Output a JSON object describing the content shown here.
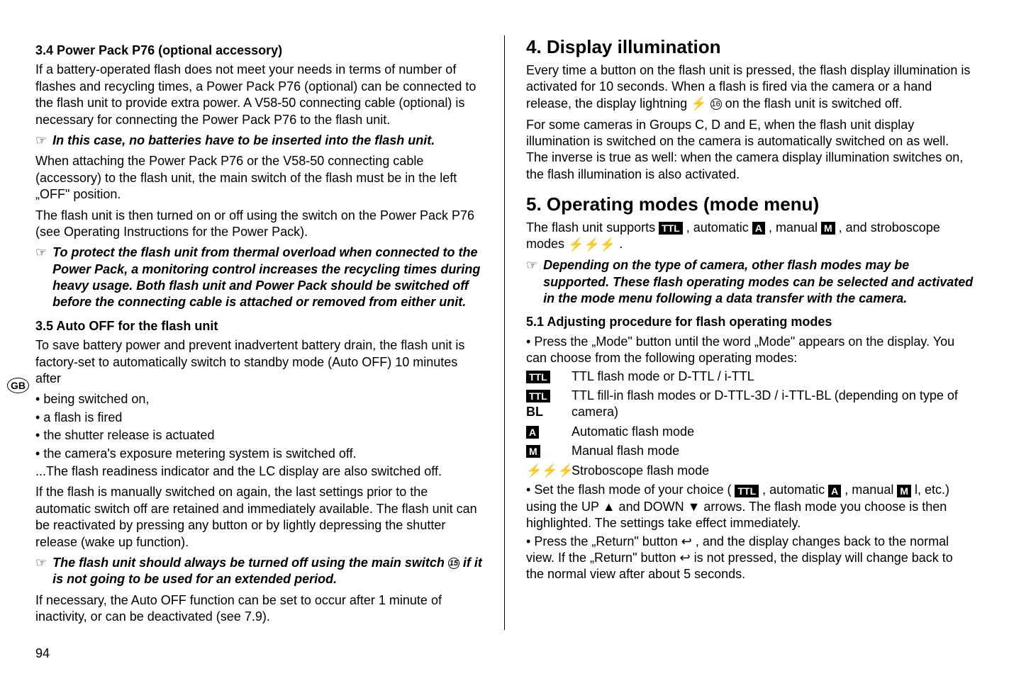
{
  "left": {
    "h34": "3.4 Power Pack P76 (optional accessory)",
    "p34a": "If a battery-operated flash does not meet your needs in terms of number of flashes and recycling times, a Power Pack P76 (optional) can be connected to the flash unit to provide extra power. A V58-50 connecting cable (optional) is necessary for connecting the Power Pack P76 to the flash unit.",
    "n34a": "In this case, no batteries have to be inserted into the flash unit.",
    "p34b": "When attaching the Power Pack P76 or the V58-50 connecting cable (accessory) to the flash unit, the main switch of the flash must be in the left „OFF\" position.",
    "p34c": "The flash unit is then turned on or off using the switch on the Power Pack P76 (see Operating Instructions for the Power Pack).",
    "n34b": "To protect the flash unit from thermal overload when connected to the Power Pack, a monitoring control increases the recycling times during heavy usage. Both flash unit and Power Pack should be switched off before the connecting cable is attached or removed from either unit.",
    "h35": "3.5 Auto OFF for the flash unit",
    "p35a": "To save battery power and prevent inadvertent battery drain, the flash unit is factory-set to automatically switch to standby mode (Auto OFF) 10 minutes after",
    "li1": "being switched on,",
    "li2": "a flash is fired",
    "li3": "the shutter release is actuated",
    "li4": "the camera's exposure metering system is switched off.",
    "p35b": "...The flash readiness indicator and the LC display are also switched off.",
    "p35c": "If the flash is manually switched on again, the last settings prior to the automatic switch off are retained and immediately available. The flash unit can be reactivated by pressing any button or by lightly depressing the shutter release (wake up function).",
    "n35a_pre": "The flash unit should always be turned off using the main switch ",
    "n35a_post": " if it is not going to be used for an extended period.",
    "p35d": "If necessary, the Auto OFF function can be set to occur after 1 minute of inactivity, or can be deactivated (see 7.9)."
  },
  "right": {
    "h4": "4. Display illumination",
    "p4a_pre": "Every time a button on the flash unit is pressed, the flash display illumination is activated for 10 seconds. When a flash is fired via the camera or a hand release, the display lightning ",
    "p4a_post": " on the flash unit is switched off.",
    "p4b": "For some cameras in Groups C, D and E, when the flash unit display illumination is switched on the camera is automatically switched on as well. The inverse is true as well: when the camera display illumination switches on, the flash illumination is also activated.",
    "h5": "5. Operating modes (mode menu)",
    "p5a_pre": "The flash unit supports ",
    "p5a_mid1": " , automatic ",
    "p5a_mid2": " , manual ",
    "p5a_mid3": " , and stroboscope modes ",
    "p5a_post": " .",
    "n5a": "Depending on the type of camera, other flash modes may be supported. These flash operating modes can be selected and activated in the mode menu following a data transfer with the camera.",
    "h51": "5.1 Adjusting procedure for flash operating modes",
    "li51a": "Press the „Mode\" button until the word „Mode\" appears on the display. You can choose from the following operating modes:",
    "mode_ttl": "TTL flash mode or D-TTL / i-TTL",
    "mode_ttlbl_suffix": "BL",
    "mode_ttlbl": "TTL fill-in flash modes or D-TTL-3D / i-TTL-BL (depending on type of camera)",
    "mode_a": "Automatic flash mode",
    "mode_m": "Manual flash mode",
    "mode_strobo": "Stroboscope flash mode",
    "li51b_pre": "Set the flash mode of your choice ( ",
    "li51b_mid1": " , automatic ",
    "li51b_mid2": " , manual ",
    "li51b_mid3": " l, etc.) using the UP ▲ and DOWN ▼ arrows. The flash mode you choose is then highlighted. The settings take effect immediately.",
    "li51c": "Press the „Return\" button ↩ , and the display changes back to the normal view.  If the „Return\" button ↩ is not pressed, the display will change back to the normal view after about 5 seconds."
  },
  "badges": {
    "ttl": "TTL",
    "a": "A",
    "m": "M"
  },
  "gb": "GB",
  "pagenum": "94"
}
